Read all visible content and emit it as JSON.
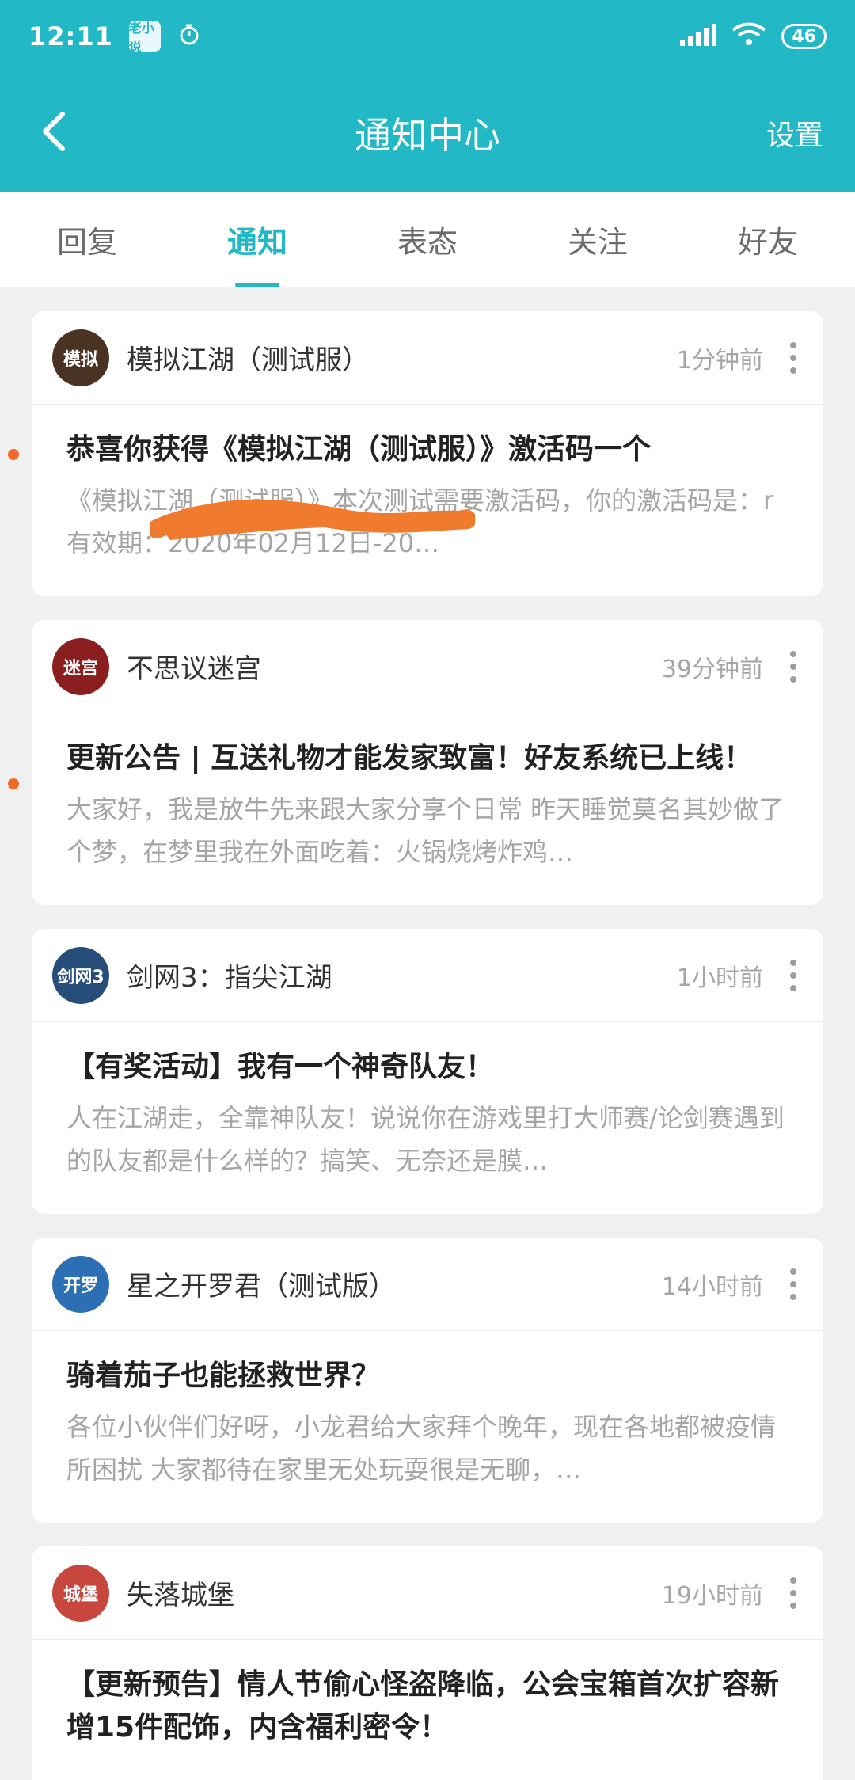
{
  "status": {
    "time": "12:11",
    "app_icon_text": "老小说",
    "battery": "46",
    "icons": [
      "app-notification-icon",
      "alarm-icon",
      "signal-icon",
      "wifi-icon",
      "battery-icon"
    ]
  },
  "toolbar": {
    "title": "通知中心",
    "settings": "设置",
    "back_icon": "chevron-left-icon"
  },
  "tabs": [
    {
      "label": "回复",
      "active": false
    },
    {
      "label": "通知",
      "active": true
    },
    {
      "label": "表态",
      "active": false
    },
    {
      "label": "关注",
      "active": false
    },
    {
      "label": "好友",
      "active": false
    }
  ],
  "cards": [
    {
      "game": "模拟江湖（测试服）",
      "time": "1分钟前",
      "title": "恭喜你获得《模拟江湖（测试服）》激活码一个",
      "text": "《模拟江湖（测试服）》本次测试需要激活码，你的激活码是：r                           有效期：2020年02月12日-20…",
      "unread": true,
      "avatar_color": "#4a3323",
      "avatar_text": "模拟"
    },
    {
      "game": "不思议迷宫",
      "time": "39分钟前",
      "title": "更新公告 | 互送礼物才能发家致富！好友系统已上线！",
      "text": "大家好，我是放牛先来跟大家分享个日常 昨天睡觉莫名其妙做了个梦，在梦里我在外面吃着：火锅烧烤炸鸡…",
      "unread": true,
      "avatar_color": "#8b1f1f",
      "avatar_text": "迷宫"
    },
    {
      "game": "剑网3：指尖江湖",
      "time": "1小时前",
      "title": "【有奖活动】我有一个神奇队友！",
      "text": "人在江湖走，全靠神队友！说说你在游戏里打大师赛/论剑赛遇到的队友都是什么样的？搞笑、无奈还是膜…",
      "unread": false,
      "avatar_color": "#274d7a",
      "avatar_text": "剑网3"
    },
    {
      "game": "星之开罗君（测试版）",
      "time": "14小时前",
      "title": "骑着茄子也能拯救世界？",
      "text": "各位小伙伴们好呀，小龙君给大家拜个晚年，现在各地都被疫情所困扰  大家都待在家里无处玩耍很是无聊，…",
      "unread": false,
      "avatar_color": "#2c6fb5",
      "avatar_text": "开罗"
    },
    {
      "game": "失落城堡",
      "time": "19小时前",
      "title": "【更新预告】情人节偷心怪盗降临，公会宝箱首次扩容新增15件配饰，内含福利密令！",
      "text": "",
      "unread": false,
      "avatar_color": "#c7473f",
      "avatar_text": "城堡"
    }
  ],
  "colors": {
    "accent": "#22b8c6",
    "unread_dot": "#ef6a2a",
    "redaction": "#f07a2e"
  }
}
